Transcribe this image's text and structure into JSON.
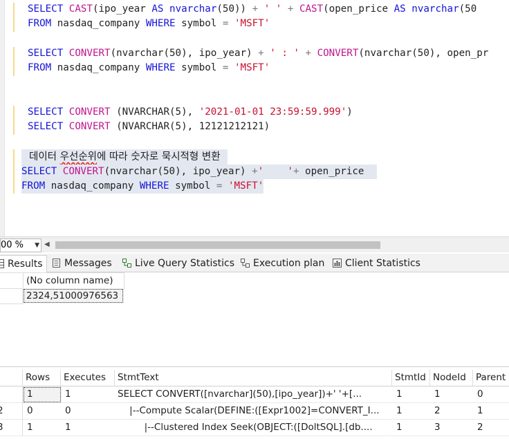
{
  "editor": {
    "q1_line1": {
      "kw_select": "SELECT",
      "fn_cast1": "CAST",
      "t_open1": "(ipo_year ",
      "kw_as1": "AS",
      "t_type1": " nvarchar",
      "t_len1": "(50)) ",
      "op_plus1": "+",
      "str_space": "' '",
      "op_plus2": "+",
      "fn_cast2": "CAST",
      "t_open2": "(open_price ",
      "kw_as2": "AS",
      "t_type2": " nvarchar",
      "t_len2": "(50"
    },
    "q1_line2": {
      "kw_from": "FROM",
      "t_table": " nasdaq_company ",
      "kw_where": "WHERE",
      "t_col": " symbol ",
      "op_eq": "=",
      "str_val": " 'MSFT'"
    },
    "q2_line1": {
      "kw_select": "SELECT",
      "fn_convert1": "CONVERT",
      "t_args1": "(nvarchar(50), ipo_year) ",
      "op_plus1": "+",
      "str_colon": "' : '",
      "op_plus2": "+",
      "fn_convert2": "CONVERT",
      "t_args2": "(nvarchar(50), open_pr"
    },
    "q2_line2": {
      "kw_from": "FROM",
      "t_table": " nasdaq_company ",
      "kw_where": "WHERE",
      "t_col": " symbol ",
      "op_eq": "=",
      "str_val": " 'MSFT'"
    },
    "q3_line1": {
      "kw_select": "SELECT",
      "fn_convert": "CONVERT",
      "t_open": " (NVARCHAR(5), ",
      "str_date": "'2021-01-01 23:59:59.999'",
      "t_close": ")"
    },
    "q4_line1": {
      "kw_select": "SELECT",
      "fn_convert": "CONVERT",
      "t_args": " (NVARCHAR(5), 12121212121)"
    },
    "comment_pre": "데이터 ",
    "comment_squig": "우선순위",
    "comment_post": "에 따라 숫자로 묵시적형 변환",
    "q5_line1": {
      "kw_select": "SELECT",
      "fn_convert": "CONVERT",
      "t_args": "(nvarchar(50), ipo_year) ",
      "op_plus": "+",
      "str_tab": "'    '",
      "op_plus2": "+",
      "t_rest": " open_price "
    },
    "q5_line2": {
      "kw_from": "FROM",
      "t_table": " nasdaq_company ",
      "kw_where": "WHERE",
      "t_col": " symbol ",
      "op_eq": "=",
      "str_val": " 'MSFT'"
    }
  },
  "statusbar": {
    "zoom": "00 %",
    "zoom_arrow": "▼",
    "scroll_left": "◀"
  },
  "tabs": [
    {
      "label": "Results",
      "icon": "grid-icon"
    },
    {
      "label": "Messages",
      "icon": "messages-icon"
    },
    {
      "label": "Live Query Statistics",
      "icon": "live-stats-icon"
    },
    {
      "label": "Execution plan",
      "icon": "execution-plan-icon"
    },
    {
      "label": "Client Statistics",
      "icon": "client-stats-icon"
    }
  ],
  "results": {
    "header": "(No column name)",
    "value": "2324,51000976563"
  },
  "plan": {
    "headers": [
      "Rows",
      "Executes",
      "StmtText",
      "StmtId",
      "NodeId",
      "Parent"
    ],
    "rows": [
      {
        "rownum": "",
        "rows": "1",
        "executes": "1",
        "stmt": " SELECT CONVERT([nvarchar](50),[ipo_year])+'    '+[...",
        "stmtid": "1",
        "nodeid": "1",
        "parent": "0"
      },
      {
        "rownum": "2",
        "rows": "0",
        "executes": "0",
        "stmt": "    |--Compute Scalar(DEFINE:([Expr1002]=CONVERT_I...",
        "stmtid": "1",
        "nodeid": "2",
        "parent": "1"
      },
      {
        "rownum": "3",
        "rows": "1",
        "executes": "1",
        "stmt": "         |--Clustered Index Seek(OBJECT:([DoltSQL].[db....",
        "stmtid": "1",
        "nodeid": "3",
        "parent": "2"
      }
    ]
  },
  "colors": {
    "keyword": "#1414d8",
    "string": "#c8102e",
    "function": "#c0148c",
    "selection": "#e3e8f0",
    "change_bar": "#f5d98a"
  }
}
